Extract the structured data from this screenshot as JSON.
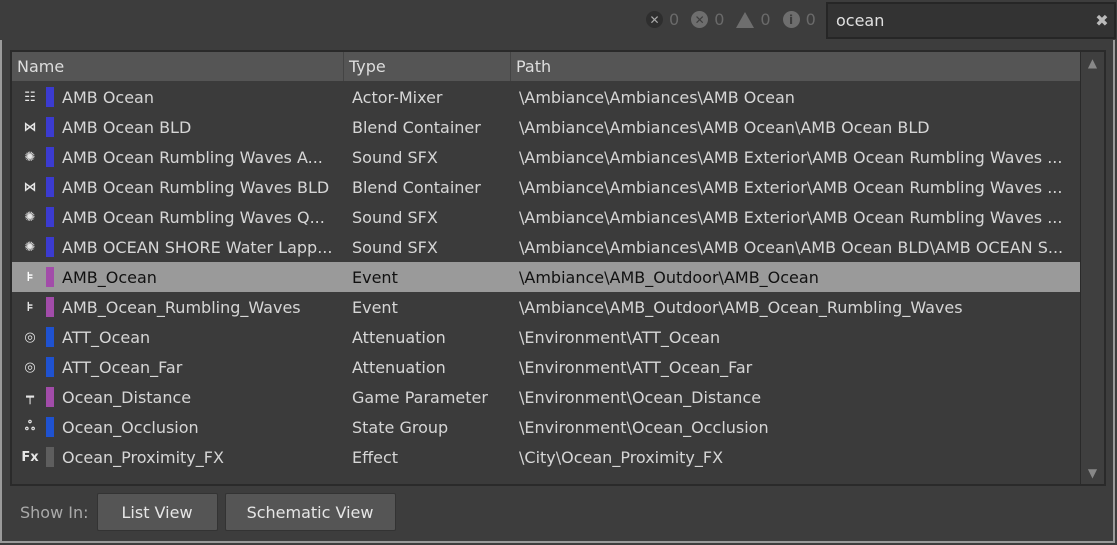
{
  "status": {
    "errors": "0",
    "critical": "0",
    "warnings": "0",
    "info": "0"
  },
  "search": {
    "value": "ocean"
  },
  "columns": [
    "Name",
    "Type",
    "Path"
  ],
  "rows": [
    {
      "name": "AMB Ocean",
      "type": "Actor-Mixer",
      "path": "\\Ambiance\\Ambiances\\AMB Ocean",
      "icon": "actor-mixer-icon",
      "glyph": "☷",
      "color": "#3b3bd0"
    },
    {
      "name": "AMB Ocean BLD",
      "type": "Blend Container",
      "path": "\\Ambiance\\Ambiances\\AMB Ocean\\AMB Ocean BLD",
      "icon": "blend-container-icon",
      "glyph": "⋈",
      "color": "#3b3bd0"
    },
    {
      "name": "AMB Ocean Rumbling Waves A...",
      "type": "Sound SFX",
      "path": "\\Ambiance\\Ambiances\\AMB Exterior\\AMB Ocean Rumbling Waves ...",
      "icon": "sound-sfx-icon",
      "glyph": "✺",
      "color": "#3b3bd0"
    },
    {
      "name": "AMB Ocean Rumbling Waves BLD",
      "type": "Blend Container",
      "path": "\\Ambiance\\Ambiances\\AMB Exterior\\AMB Ocean Rumbling Waves ...",
      "icon": "blend-container-icon",
      "glyph": "⋈",
      "color": "#3b3bd0"
    },
    {
      "name": "AMB Ocean Rumbling Waves Q...",
      "type": "Sound SFX",
      "path": "\\Ambiance\\Ambiances\\AMB Exterior\\AMB Ocean Rumbling Waves ...",
      "icon": "sound-sfx-icon",
      "glyph": "✺",
      "color": "#3b3bd0"
    },
    {
      "name": "AMB OCEAN SHORE Water Lapp...",
      "type": "Sound SFX",
      "path": "\\Ambiance\\Ambiances\\AMB Ocean\\AMB Ocean BLD\\AMB OCEAN S...",
      "icon": "sound-sfx-icon",
      "glyph": "✺",
      "color": "#3b3bd0"
    },
    {
      "name": "AMB_Ocean",
      "type": "Event",
      "path": "\\Ambiance\\AMB_Outdoor\\AMB_Ocean",
      "icon": "event-icon",
      "glyph": "⊧",
      "color": "#a24ca9",
      "selected": true
    },
    {
      "name": "AMB_Ocean_Rumbling_Waves",
      "type": "Event",
      "path": "\\Ambiance\\AMB_Outdoor\\AMB_Ocean_Rumbling_Waves",
      "icon": "event-icon",
      "glyph": "⊧",
      "color": "#a24ca9"
    },
    {
      "name": "ATT_Ocean",
      "type": "Attenuation",
      "path": "\\Environment\\ATT_Ocean",
      "icon": "attenuation-icon",
      "glyph": "◎",
      "color": "#1f52d0"
    },
    {
      "name": "ATT_Ocean_Far",
      "type": "Attenuation",
      "path": "\\Environment\\ATT_Ocean_Far",
      "icon": "attenuation-icon",
      "glyph": "◎",
      "color": "#1f52d0"
    },
    {
      "name": "Ocean_Distance",
      "type": "Game Parameter",
      "path": "\\Environment\\Ocean_Distance",
      "icon": "game-parameter-icon",
      "glyph": "┯",
      "color": "#a24ca9"
    },
    {
      "name": "Ocean_Occlusion",
      "type": "State Group",
      "path": "\\Environment\\Ocean_Occlusion",
      "icon": "state-group-icon",
      "glyph": "ஃ",
      "color": "#1f52d0"
    },
    {
      "name": "Ocean_Proximity_FX",
      "type": "Effect",
      "path": "\\City\\Ocean_Proximity_FX",
      "icon": "effect-icon",
      "glyph": "Fx",
      "color": "#5e5e5e"
    }
  ],
  "footer": {
    "label": "Show In:",
    "list_view": "List View",
    "schematic_view": "Schematic View"
  }
}
